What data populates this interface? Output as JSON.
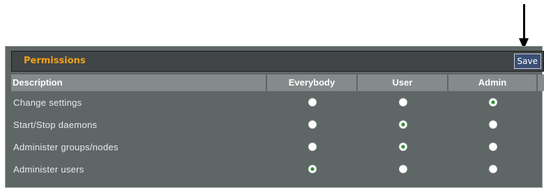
{
  "panel": {
    "title": "Permissions",
    "save_label": "Save"
  },
  "table": {
    "headers": {
      "description": "Description",
      "everybody": "Everybody",
      "user": "User",
      "admin": "Admin"
    },
    "rows": [
      {
        "description": "Change settings",
        "selected": "admin"
      },
      {
        "description": "Start/Stop daemons",
        "selected": "user"
      },
      {
        "description": "Administer groups/nodes",
        "selected": "user"
      },
      {
        "description": "Administer users",
        "selected": "everybody"
      }
    ]
  },
  "colors": {
    "title": "#f0a21a",
    "panel_bg": "#5f6666",
    "header_bg": "#414546",
    "save_button_bg": "#3a4f74",
    "radio_selected": "#2f8a2f"
  },
  "icons": {
    "callout": "down-arrow-icon"
  }
}
